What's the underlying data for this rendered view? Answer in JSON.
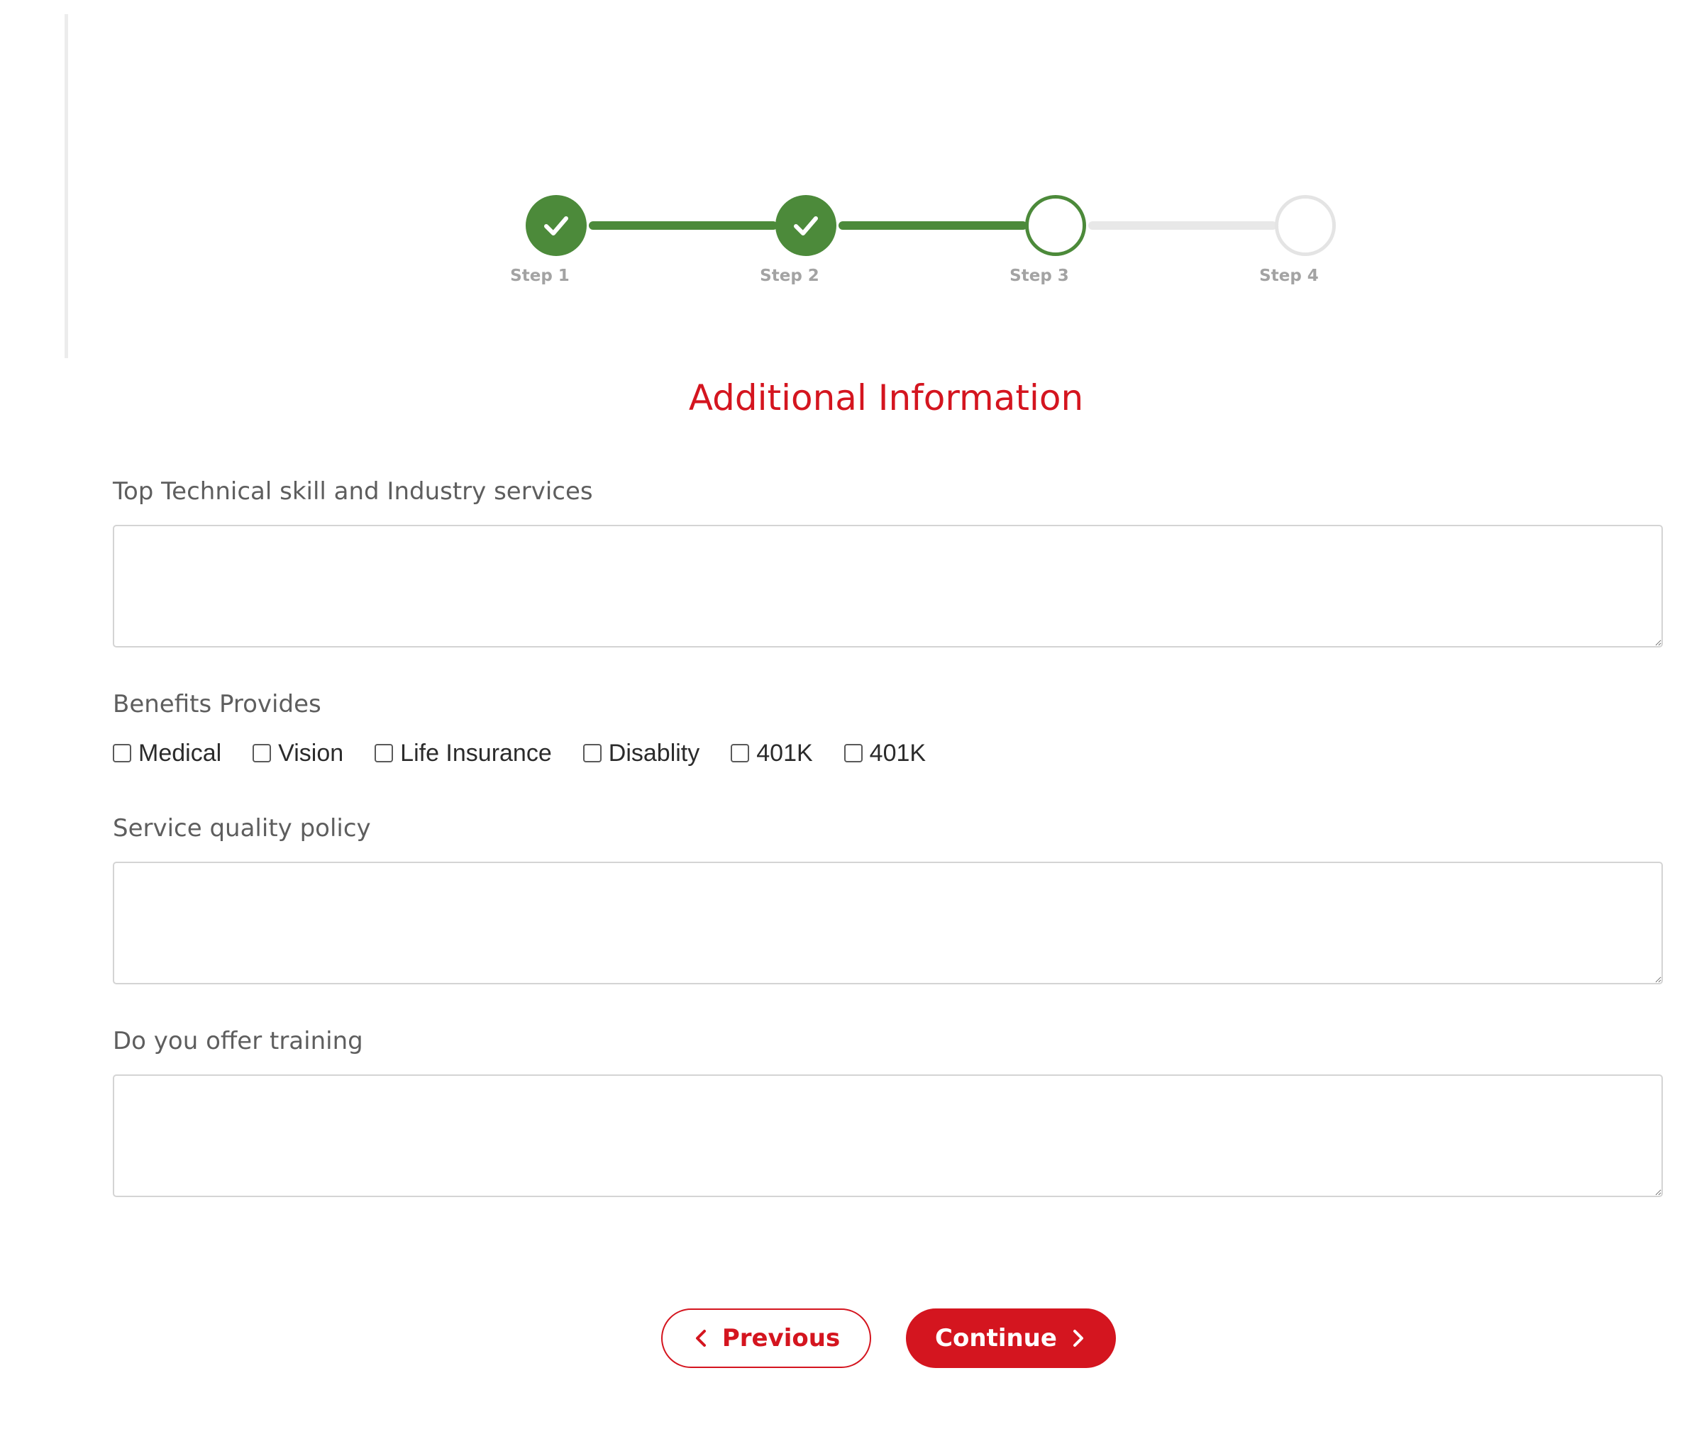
{
  "stepper": {
    "steps": [
      {
        "label": "Step 1",
        "status": "complete"
      },
      {
        "label": "Step 2",
        "status": "complete"
      },
      {
        "label": "Step 3",
        "status": "current"
      },
      {
        "label": "Step 4",
        "status": "pending"
      }
    ],
    "complete_color": "#4c8a3a",
    "pending_color": "#e4e4e4"
  },
  "title": "Additional Information",
  "form": {
    "skills": {
      "label": "Top Technical skill and Industry services",
      "value": ""
    },
    "benefits": {
      "label": "Benefits Provides",
      "options": [
        {
          "label": "Medical",
          "checked": false
        },
        {
          "label": "Vision",
          "checked": false
        },
        {
          "label": "Life Insurance",
          "checked": false
        },
        {
          "label": "Disablity",
          "checked": false
        },
        {
          "label": "401K",
          "checked": false
        },
        {
          "label": "401K",
          "checked": false
        }
      ]
    },
    "quality": {
      "label": "Service quality policy",
      "value": ""
    },
    "training": {
      "label": "Do you offer training",
      "value": ""
    }
  },
  "buttons": {
    "previous_label": "Previous",
    "continue_label": "Continue"
  },
  "colors": {
    "accent": "#d4151f",
    "success": "#4c8a3a"
  },
  "icons": {
    "check": "check-icon",
    "prev": "chevron-left-icon",
    "next": "chevron-right-icon"
  }
}
